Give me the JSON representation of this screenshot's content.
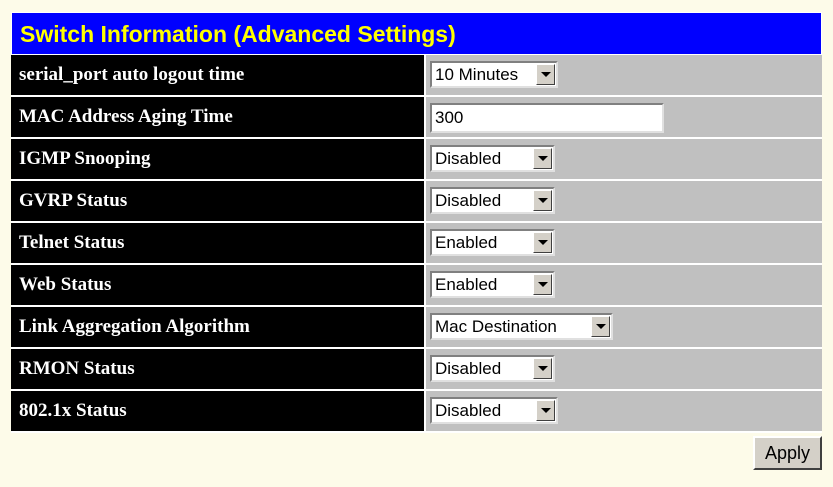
{
  "header": {
    "title": "Switch Information (Advanced Settings)"
  },
  "rows": [
    {
      "label": "serial_port auto logout time",
      "type": "select",
      "value": "10 Minutes"
    },
    {
      "label": "MAC Address Aging Time",
      "type": "text",
      "value": "300"
    },
    {
      "label": "IGMP Snooping",
      "type": "select",
      "value": "Disabled"
    },
    {
      "label": "GVRP Status",
      "type": "select",
      "value": "Disabled"
    },
    {
      "label": "Telnet Status",
      "type": "select",
      "value": "Enabled"
    },
    {
      "label": "Web Status",
      "type": "select",
      "value": "Enabled"
    },
    {
      "label": "Link Aggregation Algorithm",
      "type": "select",
      "value": "Mac Destination"
    },
    {
      "label": "RMON Status",
      "type": "select",
      "value": "Disabled"
    },
    {
      "label": "802.1x Status",
      "type": "select",
      "value": "Disabled"
    }
  ],
  "footer": {
    "apply_label": "Apply"
  },
  "colors": {
    "header_bg": "#0000ff",
    "header_text": "#ffff00",
    "label_bg": "#000000",
    "label_text": "#ffffff",
    "value_bg": "#c0c0c0",
    "page_bg": "#fdfbe9"
  },
  "icons": {
    "dropdown": "chevron-down-icon"
  }
}
